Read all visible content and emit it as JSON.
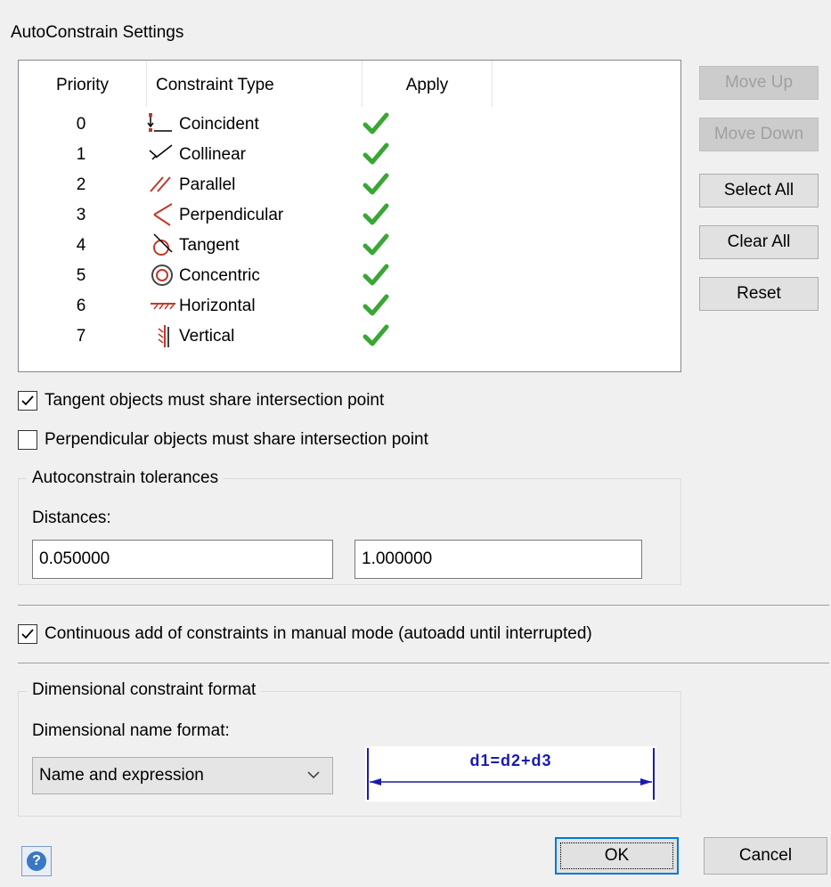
{
  "dialog": {
    "title": "AutoConstrain Settings"
  },
  "table": {
    "headers": {
      "priority": "Priority",
      "constraint_type": "Constraint Type",
      "apply": "Apply"
    },
    "rows": [
      {
        "priority": "0",
        "name": "Coincident",
        "icon": "coincident-icon",
        "applied": true
      },
      {
        "priority": "1",
        "name": "Collinear",
        "icon": "collinear-icon",
        "applied": true
      },
      {
        "priority": "2",
        "name": "Parallel",
        "icon": "parallel-icon",
        "applied": true
      },
      {
        "priority": "3",
        "name": "Perpendicular",
        "icon": "perpendicular-icon",
        "applied": true
      },
      {
        "priority": "4",
        "name": "Tangent",
        "icon": "tangent-icon",
        "applied": true
      },
      {
        "priority": "5",
        "name": "Concentric",
        "icon": "concentric-icon",
        "applied": true
      },
      {
        "priority": "6",
        "name": "Horizontal",
        "icon": "horizontal-icon",
        "applied": true
      },
      {
        "priority": "7",
        "name": "Vertical",
        "icon": "vertical-icon",
        "applied": true
      }
    ]
  },
  "side_buttons": {
    "move_up": "Move Up",
    "move_down": "Move Down",
    "select_all": "Select All",
    "clear_all": "Clear All",
    "reset": "Reset"
  },
  "options": {
    "tangent_share": {
      "label": "Tangent objects must share intersection point",
      "checked": true
    },
    "perpendicular_share": {
      "label": "Perpendicular objects must share intersection point",
      "checked": false
    },
    "continuous_add": {
      "label": "Continuous add of constraints in manual mode (autoadd until interrupted)",
      "checked": true
    }
  },
  "tolerances": {
    "legend": "Autoconstrain tolerances",
    "distances_label": "Distances:",
    "distance_value": "0.050000",
    "angle_value": "1.000000"
  },
  "dimensional": {
    "legend": "Dimensional constraint format",
    "name_format_label": "Dimensional name format:",
    "name_format_value": "Name and expression",
    "preview_text": "d1=d2+d3"
  },
  "footer": {
    "ok": "OK",
    "cancel": "Cancel",
    "help": "?"
  },
  "colors": {
    "check_green": "#3aa635",
    "constraint_red": "#c0392b",
    "preview_blue": "#1a1ab0"
  }
}
